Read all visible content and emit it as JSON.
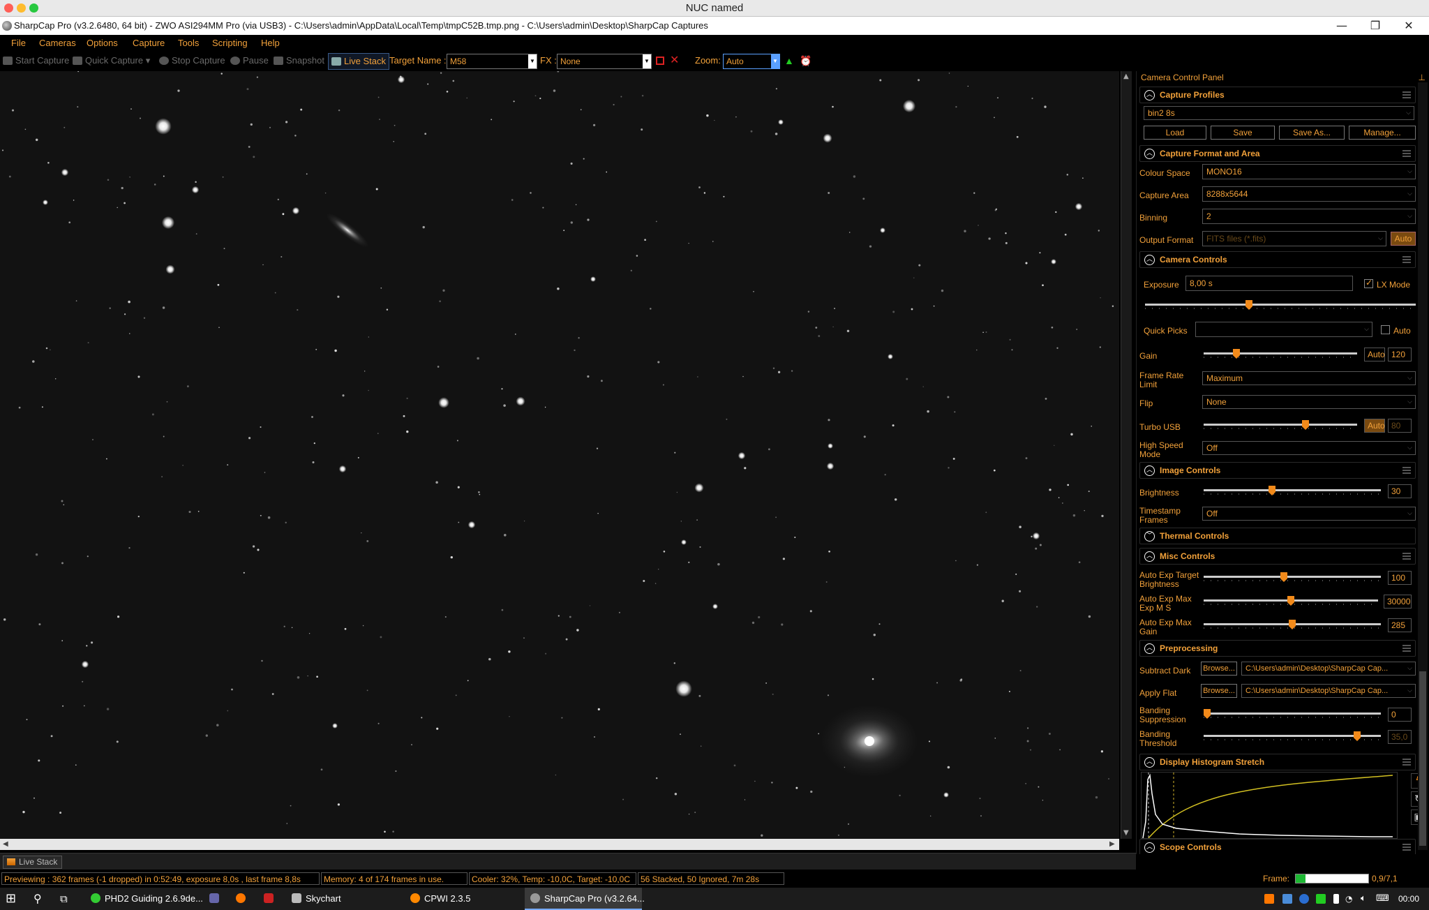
{
  "mac_window": {
    "title": "NUC named"
  },
  "app_title": "SharpCap Pro (v3.2.6480, 64 bit) - ZWO ASI294MM Pro (via USB3) - C:\\Users\\admin\\AppData\\Local\\Temp\\tmpC52B.tmp.png - C:\\Users\\admin\\Desktop\\SharpCap Captures",
  "menu": [
    "File",
    "Cameras",
    "Options",
    "Capture",
    "Tools",
    "Scripting",
    "Help"
  ],
  "toolbar": {
    "start_capture": "Start Capture",
    "quick_capture": "Quick Capture",
    "stop_capture": "Stop Capture",
    "pause": "Pause",
    "snapshot": "Snapshot",
    "live_stack": "Live Stack",
    "target_name_label": "Target Name :",
    "target_name_value": "M58",
    "fx_label": "FX :",
    "fx_value": "None",
    "zoom_label": "Zoom:",
    "zoom_value": "Auto"
  },
  "panel": {
    "header": "Camera Control Panel",
    "capture_profiles": {
      "title": "Capture Profiles",
      "profile": "bin2 8s",
      "load": "Load",
      "save": "Save",
      "save_as": "Save As...",
      "manage": "Manage..."
    },
    "capture_format": {
      "title": "Capture Format and Area",
      "colour_space_label": "Colour Space",
      "colour_space": "MONO16",
      "capture_area_label": "Capture Area",
      "capture_area": "8288x5644",
      "binning_label": "Binning",
      "binning": "2",
      "output_format_label": "Output Format",
      "output_format": "FITS files (*.fits)",
      "auto": "Auto"
    },
    "camera_controls": {
      "title": "Camera Controls",
      "exposure_label": "Exposure",
      "exposure": "8,00 s",
      "lx_mode": "LX Mode",
      "exposure_level": 0.38,
      "quick_picks_label": "Quick Picks",
      "quick_picks_auto": "Auto",
      "gain_label": "Gain",
      "gain_auto": "Auto",
      "gain": "120",
      "gain_level": 0.2,
      "frame_rate_label1": "Frame Rate",
      "frame_rate_label2": "Limit",
      "frame_rate": "Maximum",
      "flip_label": "Flip",
      "flip": "None",
      "turbo_label": "Turbo USB",
      "turbo_auto": "Auto",
      "turbo": "80",
      "turbo_level": 0.67,
      "hs_label1": "High Speed",
      "hs_label2": "Mode",
      "hs": "Off"
    },
    "image_controls": {
      "title": "Image Controls",
      "brightness_label": "Brightness",
      "brightness": "30",
      "brightness_level": 0.38,
      "timestamp_label1": "Timestamp",
      "timestamp_label2": "Frames",
      "timestamp": "Off"
    },
    "thermal": {
      "title": "Thermal Controls"
    },
    "misc": {
      "title": "Misc Controls",
      "aet_label1": "Auto Exp Target",
      "aet_label2": "Brightness",
      "aet": "100",
      "aet_level": 0.45,
      "aem_label1": "Auto Exp Max",
      "aem_label2": "Exp M S",
      "aem": "30000",
      "aem_level": 0.5,
      "aeg_label1": "Auto Exp Max",
      "aeg_label2": "Gain",
      "aeg": "285",
      "aeg_level": 0.5
    },
    "preprocessing": {
      "title": "Preprocessing",
      "dark_label": "Subtract Dark",
      "dark_browse": "Browse...",
      "dark_path": "C:\\Users\\admin\\Desktop\\SharpCap Cap...",
      "flat_label": "Apply Flat",
      "flat_browse": "Browse...",
      "flat_path": "C:\\Users\\admin\\Desktop\\SharpCap Cap...",
      "band_sup_label1": "Banding",
      "band_sup_label2": "Suppression",
      "band_sup": "0",
      "band_sup_level": 0.0,
      "band_thr_label1": "Banding",
      "band_thr_label2": "Threshold",
      "band_thr": "35,0",
      "band_thr_level": 0.88
    },
    "histogram": {
      "title": "Display Histogram Stretch"
    },
    "scope": {
      "title": "Scope Controls"
    }
  },
  "bottom_tab": "Live Stack",
  "status": {
    "previewing": "Previewing : 362 frames (-1 dropped) in 0:52:49, exposure 8,0s , last frame 8,8s",
    "memory": "Memory: 4 of 174 frames in use.",
    "cooler": "Cooler: 32%, Temp: -10,0C, Target: -10,0C",
    "stacked": "56 Stacked, 50 Ignored, 7m 28s",
    "frame_label": "Frame:",
    "frame_value": "0,9/7,1",
    "frame_level": 0.13
  },
  "taskbar": {
    "apps": [
      "PHD2 Guiding 2.6.9de...",
      "Skychart",
      "CPWI 2.3.5",
      "SharpCap Pro (v3.2.64..."
    ],
    "clock": "00:00"
  },
  "colors": {
    "accent": "#f2a13a",
    "slider_thumb": "#f28a1a",
    "frame_bar": "#1db833"
  }
}
